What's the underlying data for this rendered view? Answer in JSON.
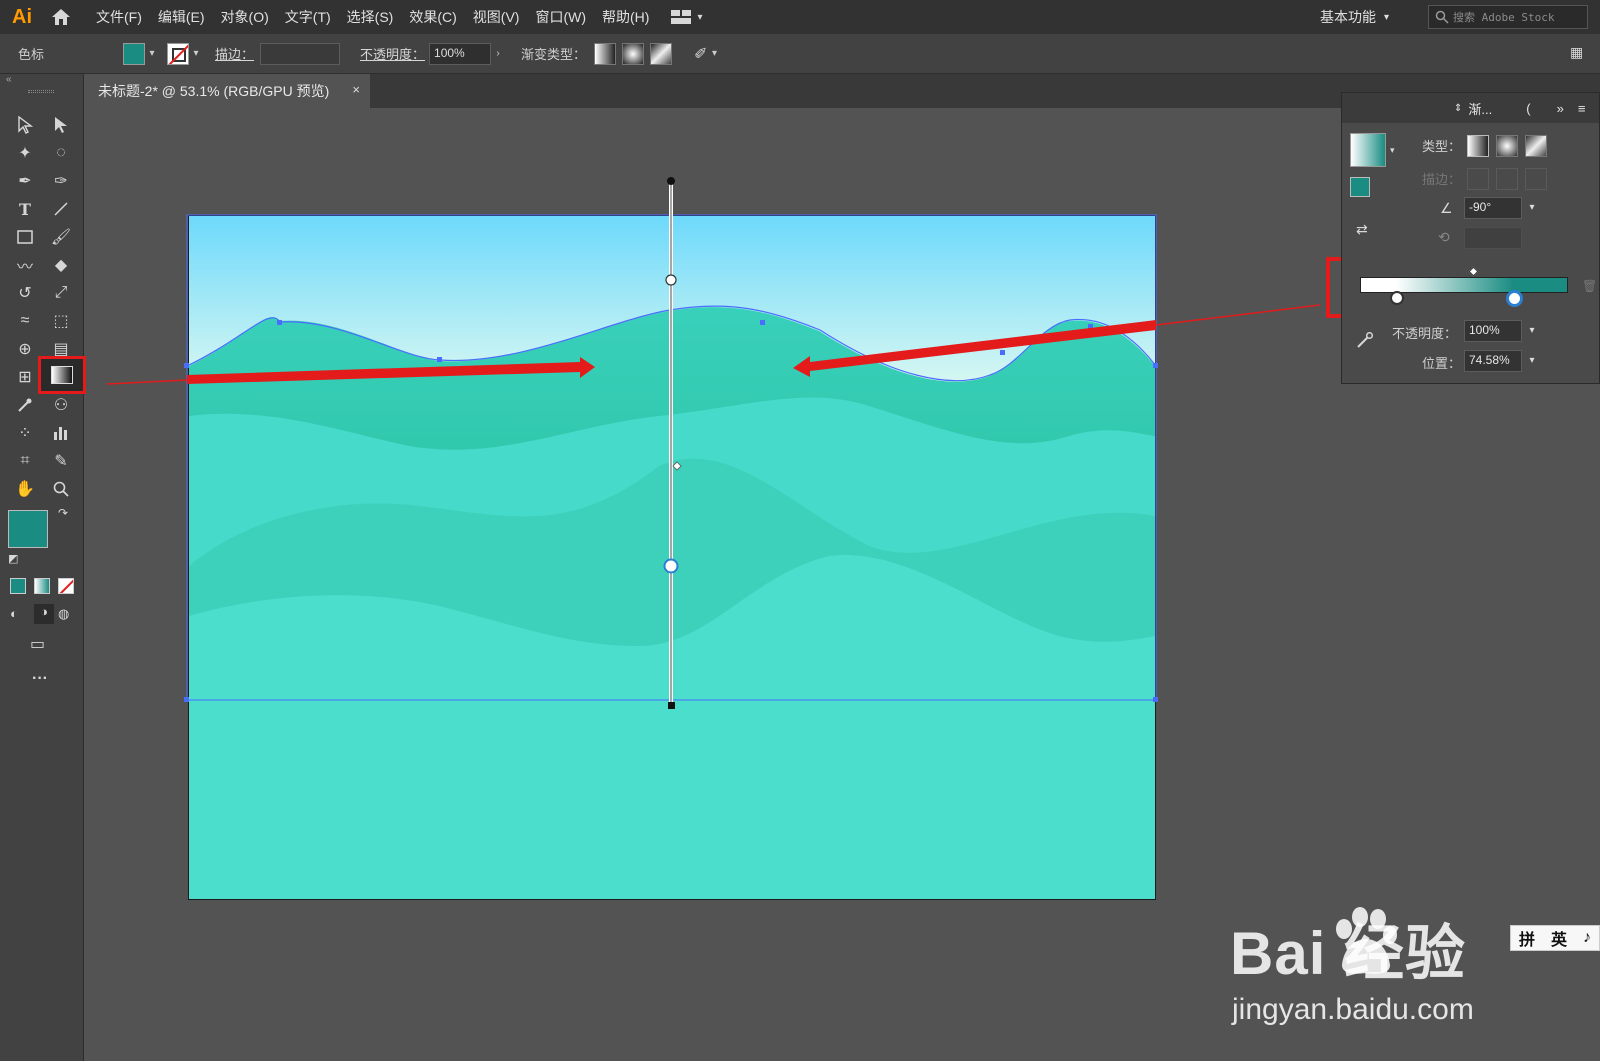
{
  "app": {
    "logo": "Ai"
  },
  "menu": [
    "文件(F)",
    "编辑(E)",
    "对象(O)",
    "文字(T)",
    "选择(S)",
    "效果(C)",
    "视图(V)",
    "窗口(W)",
    "帮助(H)"
  ],
  "workspace": {
    "label": "基本功能"
  },
  "search": {
    "placeholder": "搜索 Adobe Stock"
  },
  "control_bar": {
    "selection_label": "色标",
    "stroke_label": "描边：",
    "opacity_label": "不透明度：",
    "opacity_value": "100%",
    "gradient_type_label": "渐变类型："
  },
  "document": {
    "tab_title": "未标题-2* @ 53.1% (RGB/GPU 预览)",
    "close": "×"
  },
  "gradient_panel": {
    "tab_label": "渐...",
    "type_label": "类型：",
    "stroke_label": "描边：",
    "angle_value": "-90°",
    "opacity_label": "不透明度：",
    "opacity_value": "100%",
    "location_label": "位置：",
    "location_value": "74.58%",
    "stops": [
      {
        "color": "#ffffff",
        "location": 0.17
      },
      {
        "color": "#1a8c82",
        "location": 0.74
      }
    ]
  },
  "colors": {
    "fill": "#1a8c82",
    "sky_top": "#6dd9fb",
    "sky_bottom": "#d6f7f2",
    "sea_top": "#3fd5c4",
    "sea_bottom": "#15b182",
    "annotation_red": "#e31b1b",
    "selection_blue": "#4a6cff"
  },
  "watermark": {
    "brand": "Bai 经验",
    "url": "jingyan.baidu.com"
  },
  "ime": {
    "chars": [
      "拼",
      "英",
      "♪"
    ]
  }
}
